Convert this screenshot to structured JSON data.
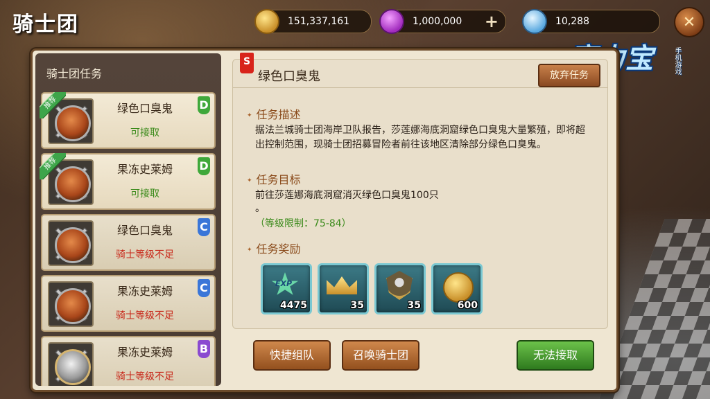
{
  "screen_title": "骑士团",
  "currencies": {
    "gold": "151,337,161",
    "gem": "1,000,000",
    "diamond": "10,288",
    "plus": "+"
  },
  "close_glyph": "✕",
  "logo": {
    "text": "魔力宝贝",
    "sub": "手机游戏"
  },
  "panel": {
    "left_title": "骑士团任务",
    "tasks": [
      {
        "name": "绿色口臭鬼",
        "status": "可接取",
        "grade": "D",
        "recommended": true
      },
      {
        "name": "果冻史莱姆",
        "status": "可接取",
        "grade": "D",
        "recommended": true
      },
      {
        "name": "绿色口臭鬼",
        "status": "骑士等级不足",
        "grade": "C",
        "recommended": false
      },
      {
        "name": "果冻史莱姆",
        "status": "骑士等级不足",
        "grade": "C",
        "recommended": false
      },
      {
        "name": "果冻史莱姆",
        "status": "骑士等级不足",
        "grade": "B",
        "recommended": false
      }
    ],
    "recommended_label": "推荐"
  },
  "detail": {
    "rank_badge": "S",
    "title": "绿色口臭鬼",
    "abandon_label": "放弃任务",
    "desc_title": "任务描述",
    "desc_text": "据法兰城骑士团海岸卫队报告，莎莲娜海底洞窟绿色口臭鬼大量繁殖，即将超出控制范围，现骑士团招募冒险者前往该地区清除部分绿色口臭鬼。",
    "goal_title": "任务目标",
    "goal_text": "前往莎莲娜海底洞窟消灭绿色口臭鬼100只",
    "goal_text2": "。",
    "level_limit": "（等级限制：75-84）",
    "reward_title": "任务奖励",
    "rewards": [
      {
        "icon": "exp-star-icon",
        "label": "EXP",
        "qty": "4475"
      },
      {
        "icon": "crown-icon",
        "qty": "35"
      },
      {
        "icon": "knight-shield-icon",
        "qty": "35"
      },
      {
        "icon": "gold-coin-icon",
        "qty": "600"
      }
    ]
  },
  "buttons": {
    "quick_team": "快捷组队",
    "summon_knights": "召唤骑士团",
    "cannot_accept": "无法接取"
  }
}
